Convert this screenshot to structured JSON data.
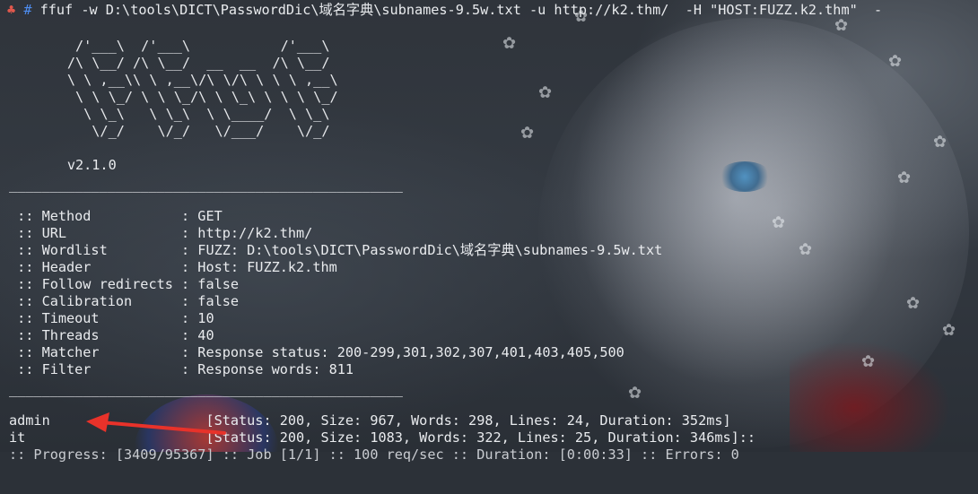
{
  "command": {
    "prompt_symbol": "♣",
    "prompt_hash": "#",
    "text": "ffuf -w D:\\tools\\DICT\\PasswordDic\\域名字典\\subnames-9.5w.txt -u http://k2.thm/  -H \"HOST:FUZZ.k2.thm\"  -"
  },
  "banner": [
    "       /'___\\  /'___\\           /'___\\",
    "      /\\ \\__/ /\\ \\__/  __  __  /\\ \\__/",
    "      \\ \\ ,__\\\\ \\ ,__\\/\\ \\/\\ \\ \\ \\ ,__\\",
    "       \\ \\ \\_/ \\ \\ \\_/\\ \\ \\_\\ \\ \\ \\ \\_/",
    "        \\ \\_\\   \\ \\_\\  \\ \\____/  \\ \\_\\",
    "         \\/_/    \\/_/   \\/___/    \\/_/"
  ],
  "version": "      v2.1.0",
  "separator": "________________________________________________",
  "config": [
    " :: Method           : GET",
    " :: URL              : http://k2.thm/",
    " :: Wordlist         : FUZZ: D:\\tools\\DICT\\PasswordDic\\域名字典\\subnames-9.5w.txt",
    " :: Header           : Host: FUZZ.k2.thm",
    " :: Follow redirects : false",
    " :: Calibration      : false",
    " :: Timeout          : 10",
    " :: Threads          : 40",
    " :: Matcher          : Response status: 200-299,301,302,307,401,403,405,500",
    " :: Filter           : Response words: 811"
  ],
  "results": [
    "admin                   [Status: 200, Size: 967, Words: 298, Lines: 24, Duration: 352ms]",
    "it                      [Status: 200, Size: 1083, Words: 322, Lines: 25, Duration: 346ms]::"
  ],
  "progress_partial": ":: Progress: [3409/95367] :: Job [1/1] :: 100 req/sec :: Duration: [0:00:33] :: Errors: 0",
  "annotation": {
    "arrow_color": "#e8322a"
  }
}
